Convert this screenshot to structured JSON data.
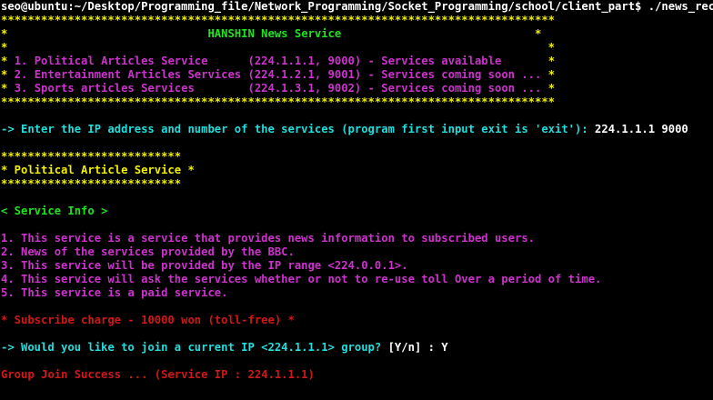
{
  "prompt": {
    "text": "seo@ubuntu:~/Desktop/Programming_file/Network_Programming/Socket_Programming/school/client_part$ ./news_receiver"
  },
  "banner": {
    "border": "***********************************************************************************",
    "row_title_left": "*                              ",
    "title": "HANSHIN News Service",
    "row_title_right": "                             *",
    "row_empty": "*                                                                                 *",
    "services": [
      {
        "star": "* ",
        "text": "1. Political Articles Service      (224.1.1.1, 9000) - Services available       ",
        "end": "*"
      },
      {
        "star": "* ",
        "text": "2. Entertainment Articles Services (224.1.2.1, 9001) - Services coming soon ... ",
        "end": "*"
      },
      {
        "star": "* ",
        "text": "3. Sports articles Services        (224.1.3.1, 9002) - Services coming soon ... ",
        "end": "*"
      }
    ]
  },
  "input_prompt": {
    "text": "-> Enter the IP address and number of the services (program first input exit is 'exit'): ",
    "value": "224.1.1.1 9000"
  },
  "article_box": {
    "border": "***************************",
    "title": "* Political Article Service *"
  },
  "service_info": {
    "header": "< Service Info >",
    "items": [
      "1. This service is a service that provides news information to subscribed users.",
      "2. News of the services provided by the BBC.",
      "3. This service will be provided by the IP range <224.0.0.1>.",
      "4. This service will ask the services whether or not to re-use toll Over a period of time.",
      "5. This service is a paid service."
    ]
  },
  "charge": {
    "text": "* Subscribe charge - 10000 won (toll-free) *"
  },
  "join_prompt": {
    "text": "-> Would you like to join a current IP <224.1.1.1> group? ",
    "options": "[Y/n] : Y"
  },
  "result": {
    "text": "Group Join Success ... (Service IP : 224.1.1.1)"
  }
}
